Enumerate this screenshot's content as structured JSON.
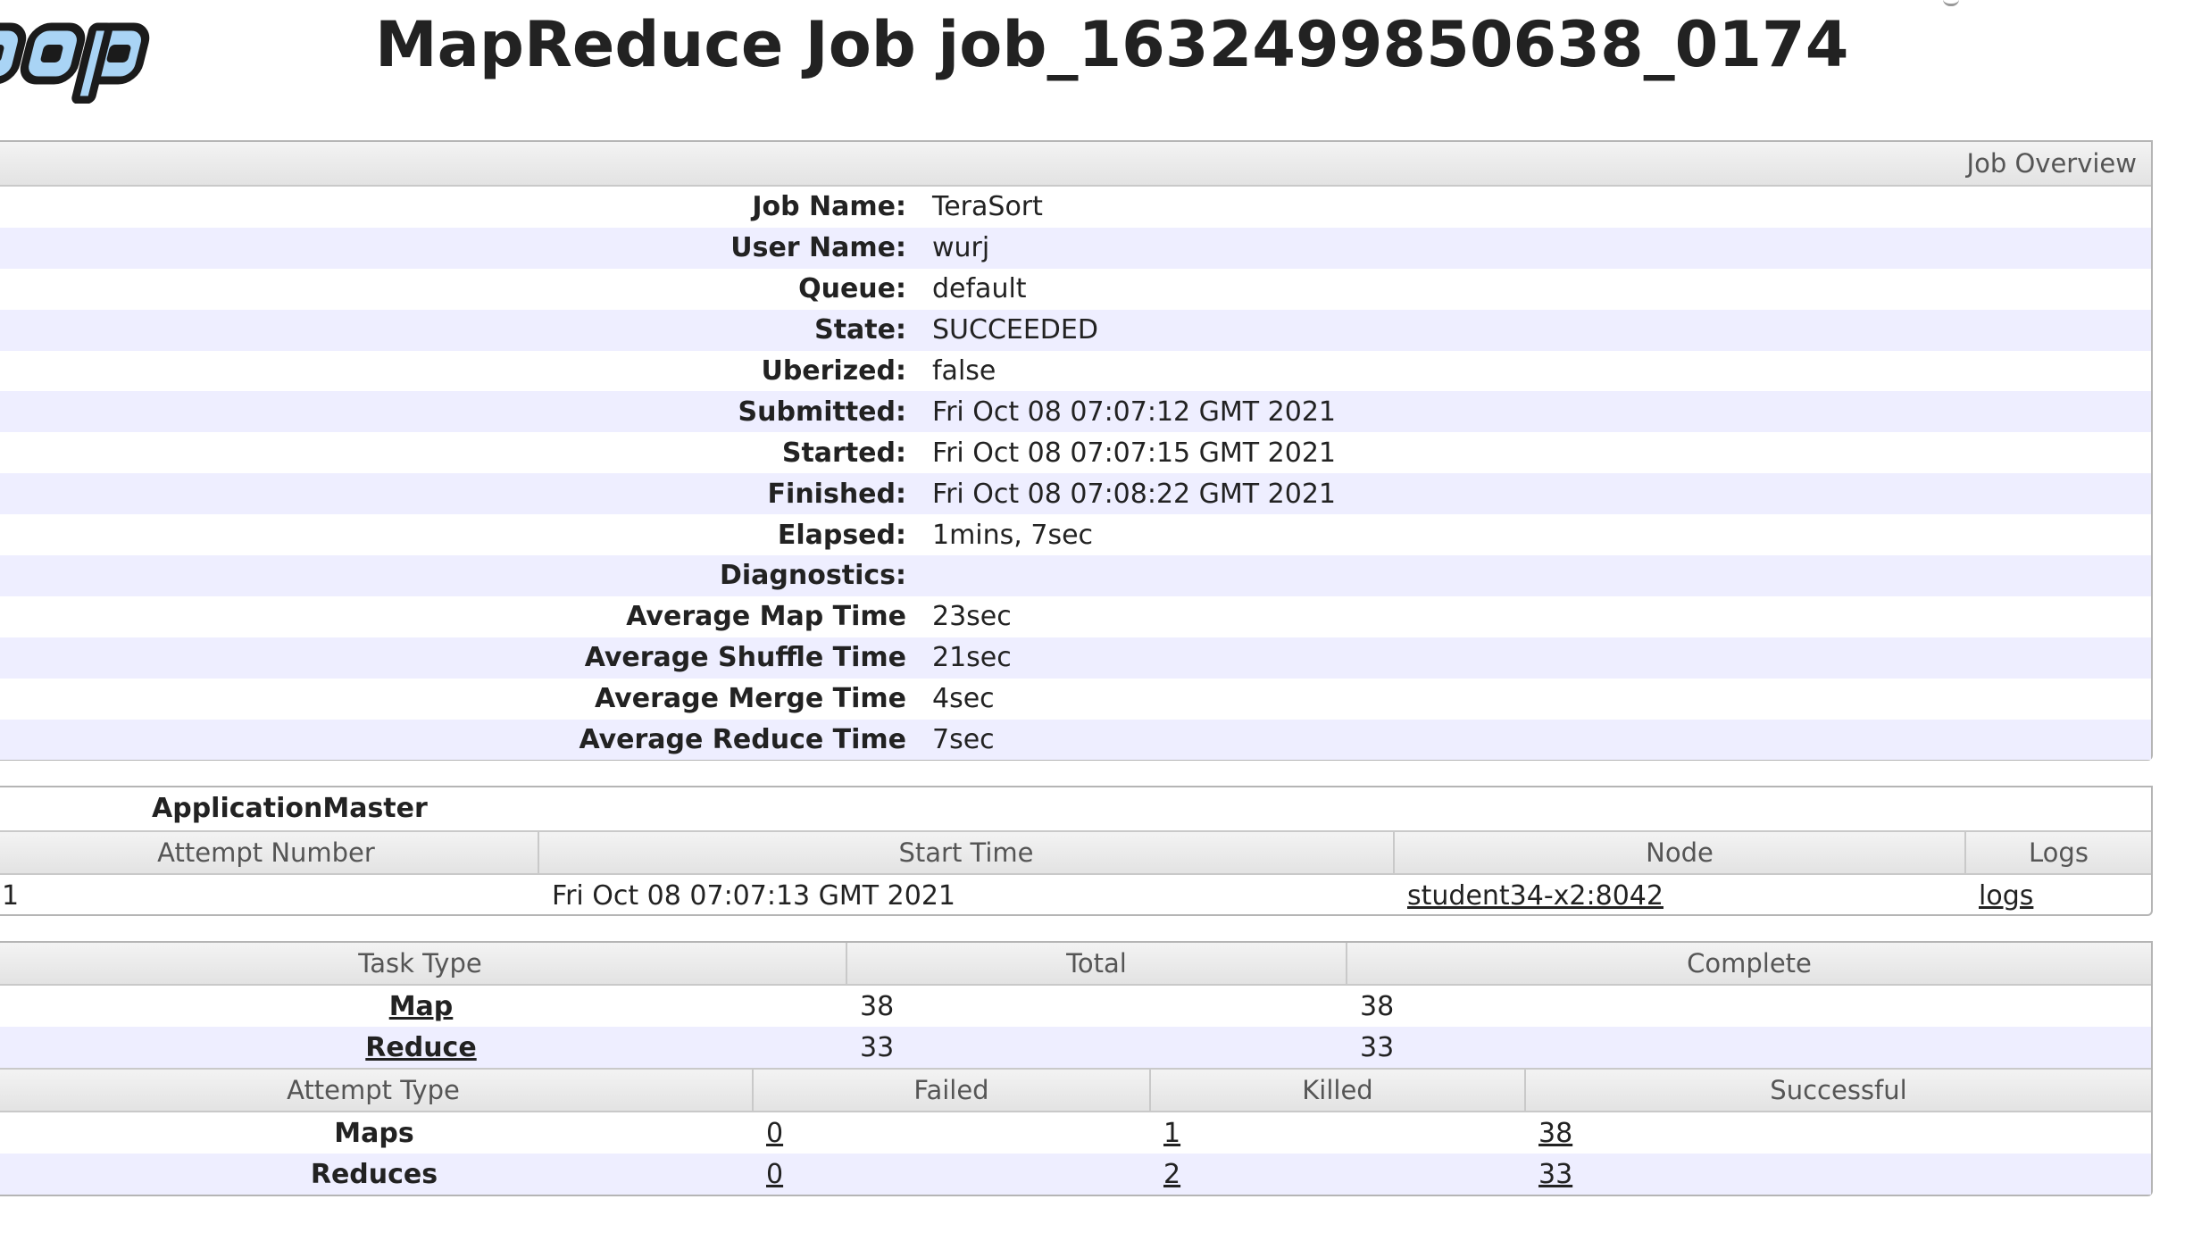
{
  "header": {
    "title": "MapReduce Job job_1632499850638_0174"
  },
  "overview": {
    "heading": "Job Overview",
    "rows": [
      {
        "label": "Job Name:",
        "value": "TeraSort"
      },
      {
        "label": "User Name:",
        "value": "wurj"
      },
      {
        "label": "Queue:",
        "value": "default"
      },
      {
        "label": "State:",
        "value": "SUCCEEDED"
      },
      {
        "label": "Uberized:",
        "value": "false"
      },
      {
        "label": "Submitted:",
        "value": "Fri Oct 08 07:07:12 GMT 2021"
      },
      {
        "label": "Started:",
        "value": "Fri Oct 08 07:07:15 GMT 2021"
      },
      {
        "label": "Finished:",
        "value": "Fri Oct 08 07:08:22 GMT 2021"
      },
      {
        "label": "Elapsed:",
        "value": "1mins, 7sec"
      },
      {
        "label": "Diagnostics:",
        "value": ""
      },
      {
        "label": "Average Map Time",
        "value": "23sec"
      },
      {
        "label": "Average Shuffle Time",
        "value": "21sec"
      },
      {
        "label": "Average Merge Time",
        "value": "4sec"
      },
      {
        "label": "Average Reduce Time",
        "value": "7sec"
      }
    ]
  },
  "application_master": {
    "caption": "ApplicationMaster",
    "columns": [
      "Attempt Number",
      "Start Time",
      "Node",
      "Logs"
    ],
    "rows": [
      {
        "attempt": "1",
        "start_time": "Fri Oct 08 07:07:13 GMT 2021",
        "node": "student34-x2:8042",
        "logs": "logs"
      }
    ]
  },
  "tasks": {
    "columns": [
      "Task Type",
      "Total",
      "Complete"
    ],
    "rows": [
      {
        "type": "Map",
        "total": "38",
        "complete": "38"
      },
      {
        "type": "Reduce",
        "total": "33",
        "complete": "33"
      }
    ]
  },
  "attempts": {
    "columns": [
      "Attempt Type",
      "Failed",
      "Killed",
      "Successful"
    ],
    "rows": [
      {
        "type": "Maps",
        "failed": "0",
        "killed": "1",
        "successful": "38"
      },
      {
        "type": "Reduces",
        "failed": "0",
        "killed": "2",
        "successful": "33"
      }
    ]
  },
  "colors": {
    "row_alt": "#eeeeff",
    "header_bg": "#e3e3e3",
    "logo_fill": "#a9d4f5",
    "logo_outline": "#1b1b1b"
  },
  "icons": {
    "logo": "hadoop-logo"
  }
}
